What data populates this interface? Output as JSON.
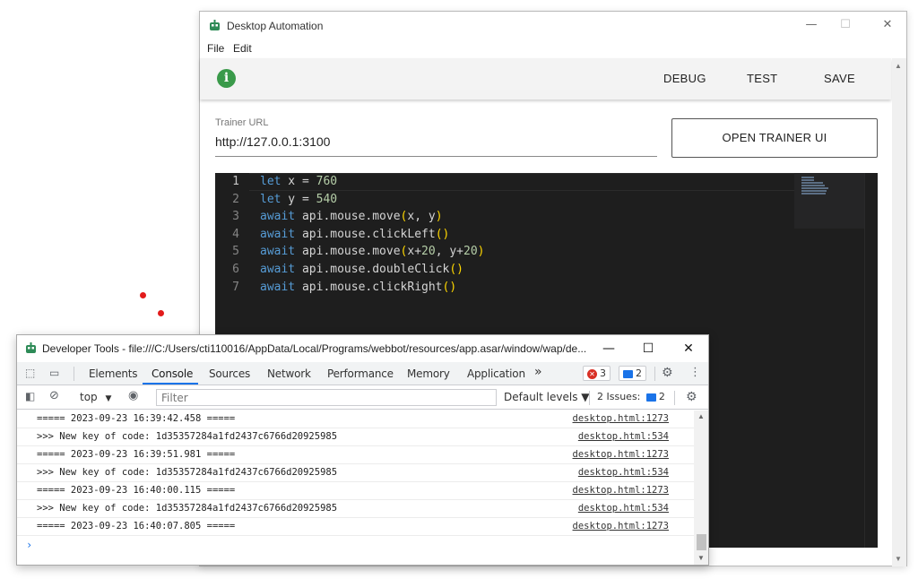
{
  "app": {
    "title": "Desktop Automation",
    "menu": [
      "File",
      "Edit"
    ],
    "toolbar": {
      "info_icon": "i",
      "debug": "DEBUG",
      "test": "TEST",
      "save": "SAVE"
    },
    "trainer": {
      "label": "Trainer URL",
      "value": "http://127.0.0.1:3100",
      "button": "OPEN TRAINER UI"
    },
    "window_controls": {
      "minimize": "—",
      "maximize": "☐",
      "close": "✕"
    },
    "code_lines": [
      {
        "n": "1",
        "tokens": [
          [
            "kw",
            "let"
          ],
          [
            "",
            " x = "
          ],
          [
            "num",
            "760"
          ]
        ]
      },
      {
        "n": "2",
        "tokens": [
          [
            "kw",
            "let"
          ],
          [
            "",
            " y = "
          ],
          [
            "num",
            "540"
          ]
        ]
      },
      {
        "n": "3",
        "tokens": [
          [
            "kw",
            "await"
          ],
          [
            "",
            " api.mouse.move"
          ],
          [
            "paren",
            "("
          ],
          [
            "",
            "x, y"
          ],
          [
            "paren",
            ")"
          ]
        ]
      },
      {
        "n": "4",
        "tokens": [
          [
            "kw",
            "await"
          ],
          [
            "",
            " api.mouse.clickLeft"
          ],
          [
            "paren",
            "()"
          ]
        ]
      },
      {
        "n": "5",
        "tokens": [
          [
            "kw",
            "await"
          ],
          [
            "",
            " api.mouse.move"
          ],
          [
            "paren",
            "("
          ],
          [
            "",
            "x+"
          ],
          [
            "num",
            "20"
          ],
          [
            "",
            ", y+"
          ],
          [
            "num",
            "20"
          ],
          [
            "paren",
            ")"
          ]
        ]
      },
      {
        "n": "6",
        "tokens": [
          [
            "kw",
            "await"
          ],
          [
            "",
            " api.mouse.doubleClick"
          ],
          [
            "paren",
            "()"
          ]
        ]
      },
      {
        "n": "7",
        "tokens": [
          [
            "kw",
            "await"
          ],
          [
            "",
            " api.mouse.clickRight"
          ],
          [
            "paren",
            "()"
          ]
        ]
      }
    ]
  },
  "devtools": {
    "title": "Developer Tools - file:///C:/Users/cti110016/AppData/Local/Programs/webbot/resources/app.asar/window/wap/de...",
    "window_controls": {
      "minimize": "—",
      "maximize": "☐",
      "close": "✕"
    },
    "tabs": [
      "Elements",
      "Console",
      "Sources",
      "Network",
      "Performance",
      "Memory",
      "Application"
    ],
    "active_tab": "Console",
    "more_tabs": "»",
    "errors_count": "3",
    "messages_count": "2",
    "filter": {
      "context": "top",
      "placeholder": "Filter",
      "levels": "Default levels ▼",
      "issues_label": "2 Issues:",
      "issues_count": "2"
    },
    "logs": [
      {
        "msg": "===== 2023-09-23 16:39:42.458 =====",
        "src": "desktop.html:1273"
      },
      {
        "msg": ">>> New key of code: 1d35357284a1fd2437c6766d20925985",
        "src": "desktop.html:534"
      },
      {
        "msg": "===== 2023-09-23 16:39:51.981 =====",
        "src": "desktop.html:1273"
      },
      {
        "msg": ">>> New key of code: 1d35357284a1fd2437c6766d20925985",
        "src": "desktop.html:534"
      },
      {
        "msg": "===== 2023-09-23 16:40:00.115 =====",
        "src": "desktop.html:1273"
      },
      {
        "msg": ">>> New key of code: 1d35357284a1fd2437c6766d20925985",
        "src": "desktop.html:534"
      },
      {
        "msg": "===== 2023-09-23 16:40:07.805 =====",
        "src": "desktop.html:1273"
      }
    ],
    "prompt": "›"
  },
  "colors": {
    "accent": "#1a73e8",
    "info_green": "#3a9a4a",
    "editor_bg": "#1e1e1e",
    "keyword": "#569cd6",
    "number": "#b5cea8",
    "paren": "#ffd700",
    "error": "#d93025"
  }
}
